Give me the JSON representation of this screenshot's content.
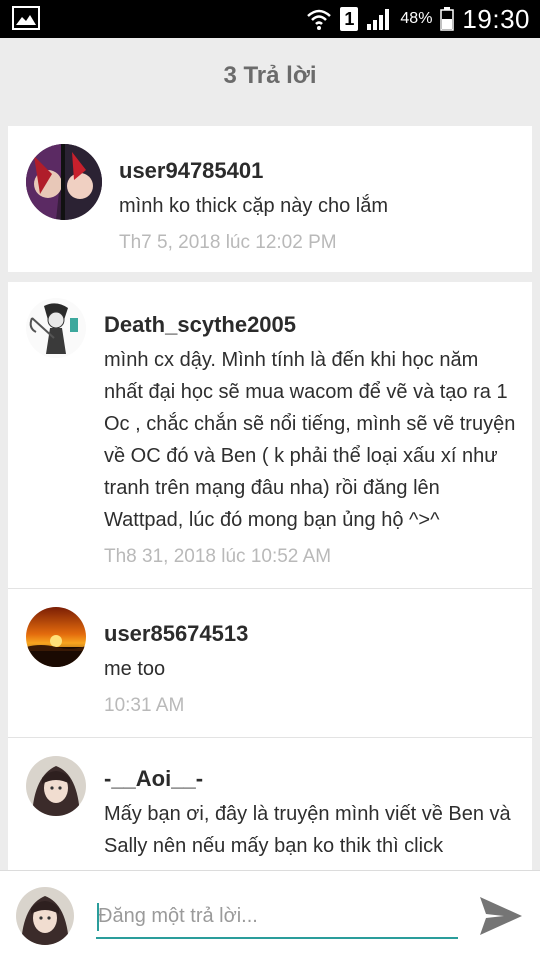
{
  "status_bar": {
    "left_icon": "image-icon",
    "sim_label": "1",
    "battery_percent": "48%",
    "time": "19:30"
  },
  "header": {
    "title": "3 Trả lời"
  },
  "comments": [
    {
      "username": "user94785401",
      "text": "mình ko thick cặp này cho lắm",
      "timestamp": "Th7 5, 2018 lúc 12:02 PM"
    },
    {
      "username": "Death_scythe2005",
      "text": "mình cx dậy. Mình tính là đến khi học năm nhất đại học sẽ mua wacom để vẽ và tạo ra 1 Oc , chắc chắn sẽ nổi tiếng, mình sẽ vẽ truyện về OC đó và Ben ( k phải thể loại xấu xí như tranh trên mạng đâu nha) rồi đăng lên Wattpad, lúc đó mong bạn ủng hộ ^>^",
      "timestamp": "Th8 31, 2018 lúc 10:52 AM"
    },
    {
      "username": "user85674513",
      "text": "me too",
      "timestamp": "10:31 AM"
    },
    {
      "username": "-__Aoi__-",
      "text": "Mấy bạn ơi, đây là truyện mình viết về Ben và Sally nên nếu mấy bạn ko thik thì click",
      "timestamp": ""
    }
  ],
  "reply": {
    "placeholder": "Đăng một trả lời...",
    "value": ""
  },
  "colors": {
    "accent": "#2a9d9b",
    "timestamp": "#b9b9b9",
    "background": "#ececec"
  }
}
